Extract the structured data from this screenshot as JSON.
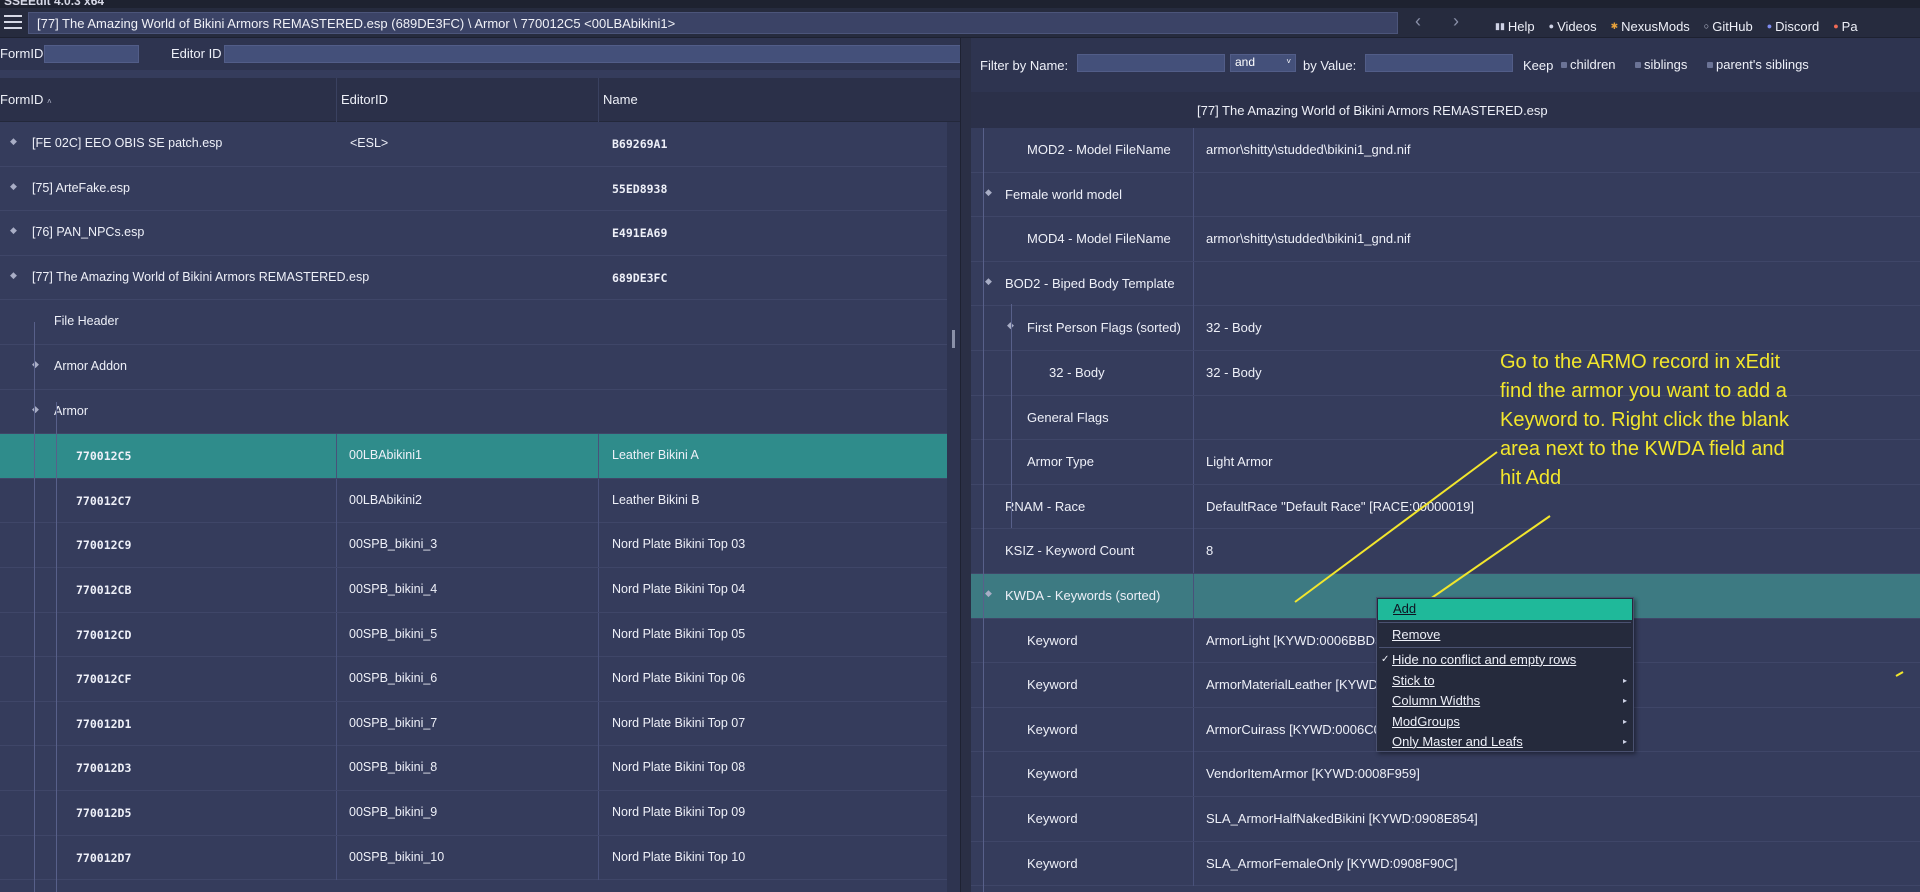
{
  "window": {
    "title": "SSEEdit 4.0.3 x64"
  },
  "topbar": {
    "path": "[77] The Amazing World of Bikini Armors REMASTERED.esp (689DE3FC) \\ Armor \\ 770012C5 <00LBAbikini1>",
    "back_icon": "chevron-left-icon",
    "forward_icon": "chevron-right-icon",
    "links": [
      {
        "label": "Help",
        "icon": "book-icon"
      },
      {
        "label": "Videos",
        "icon": "video-icon"
      },
      {
        "label": "NexusMods",
        "icon": "nexus-icon"
      },
      {
        "label": "GitHub",
        "icon": "github-icon"
      },
      {
        "label": "Discord",
        "icon": "discord-icon"
      },
      {
        "label": "Pa",
        "icon": "patreon-icon"
      }
    ]
  },
  "left": {
    "filter": {
      "formid_label": "FormID",
      "editorid_label": "Editor ID",
      "formid_value": "",
      "editorid_value": ""
    },
    "columns": {
      "formid": "FormID",
      "editorid": "EditorID",
      "name": "Name"
    },
    "rows": [
      {
        "formid": "[FE 02C] EEO OBIS SE patch.esp",
        "editorid": "<ESL>",
        "name": "B69269A1",
        "level": 0,
        "expand": true
      },
      {
        "formid": "[75] ArteFake.esp",
        "editorid": "",
        "name": "55ED8938",
        "level": 0,
        "expand": true
      },
      {
        "formid": "[76] PAN_NPCs.esp",
        "editorid": "",
        "name": "E491EA69",
        "level": 0,
        "expand": true
      },
      {
        "formid": "[77] The Amazing World of Bikini Armors REMASTERED.esp",
        "editorid": "",
        "name": "689DE3FC",
        "level": 0,
        "expand": true
      },
      {
        "formid": "File Header",
        "editorid": "",
        "name": "",
        "level": 1,
        "expand": false
      },
      {
        "formid": "Armor Addon",
        "editorid": "",
        "name": "",
        "level": 1,
        "expand": true
      },
      {
        "formid": "Armor",
        "editorid": "",
        "name": "",
        "level": 1,
        "expand": true
      },
      {
        "formid": "770012C5",
        "editorid": "00LBAbikini1",
        "name": "Leather Bikini A",
        "level": 2,
        "selected": true
      },
      {
        "formid": "770012C7",
        "editorid": "00LBAbikini2",
        "name": "Leather Bikini B",
        "level": 2
      },
      {
        "formid": "770012C9",
        "editorid": "00SPB_bikini_3",
        "name": "Nord Plate Bikini Top 03",
        "level": 2
      },
      {
        "formid": "770012CB",
        "editorid": "00SPB_bikini_4",
        "name": "Nord Plate Bikini Top 04",
        "level": 2
      },
      {
        "formid": "770012CD",
        "editorid": "00SPB_bikini_5",
        "name": "Nord Plate Bikini Top 05",
        "level": 2
      },
      {
        "formid": "770012CF",
        "editorid": "00SPB_bikini_6",
        "name": "Nord Plate Bikini Top 06",
        "level": 2
      },
      {
        "formid": "770012D1",
        "editorid": "00SPB_bikini_7",
        "name": "Nord Plate Bikini Top 07",
        "level": 2
      },
      {
        "formid": "770012D3",
        "editorid": "00SPB_bikini_8",
        "name": "Nord Plate Bikini Top 08",
        "level": 2
      },
      {
        "formid": "770012D5",
        "editorid": "00SPB_bikini_9",
        "name": "Nord Plate Bikini Top 09",
        "level": 2
      },
      {
        "formid": "770012D7",
        "editorid": "00SPB_bikini_10",
        "name": "Nord Plate Bikini Top 10",
        "level": 2
      }
    ]
  },
  "right": {
    "filter": {
      "by_name_label": "Filter by Name:",
      "name_value": "",
      "op": "and",
      "by_value_label": "by Value:",
      "value_value": "",
      "keep_label": "Keep",
      "options": [
        "children",
        "siblings",
        "parent's siblings"
      ]
    },
    "header": "[77] The Amazing World of Bikini Armors REMASTERED.esp",
    "rows": [
      {
        "label": "MOD2 - Model FileName",
        "value": "armor\\shitty\\studded\\bikini1_gnd.nif",
        "level": 2
      },
      {
        "label": "Female world model",
        "value": "",
        "level": 1,
        "expand": true
      },
      {
        "label": "MOD4 - Model FileName",
        "value": "armor\\shitty\\studded\\bikini1_gnd.nif",
        "level": 2
      },
      {
        "label": "BOD2 - Biped Body Template",
        "value": "",
        "level": 1,
        "expand": true
      },
      {
        "label": "First Person Flags (sorted)",
        "value": "32 - Body",
        "level": 2,
        "expand": true
      },
      {
        "label": "32 - Body",
        "value": "32 - Body",
        "level": 3
      },
      {
        "label": "General Flags",
        "value": "",
        "level": 2
      },
      {
        "label": "Armor Type",
        "value": "Light Armor",
        "level": 2
      },
      {
        "label": "RNAM - Race",
        "value": "DefaultRace \"Default Race\" [RACE:00000019]",
        "level": 1
      },
      {
        "label": "KSIZ - Keyword Count",
        "value": "8",
        "level": 1
      },
      {
        "label": "KWDA - Keywords (sorted)",
        "value": "",
        "level": 1,
        "expand": true,
        "kwda": true
      },
      {
        "label": "Keyword",
        "value": "ArmorLight [KYWD:0006BBD3]",
        "level": 2
      },
      {
        "label": "Keyword",
        "value": "ArmorMaterialLeather [KYWD:0006BBDB]",
        "level": 2
      },
      {
        "label": "Keyword",
        "value": "ArmorCuirass [KYWD:0006C0EC]",
        "level": 2
      },
      {
        "label": "Keyword",
        "value": "VendorItemArmor [KYWD:0008F959]",
        "level": 2
      },
      {
        "label": "Keyword",
        "value": "SLA_ArmorHalfNakedBikini [KYWD:0908E854]",
        "level": 2
      },
      {
        "label": "Keyword",
        "value": "SLA_ArmorFemaleOnly [KYWD:0908F90C]",
        "level": 2
      }
    ]
  },
  "context_menu": {
    "items": [
      {
        "label": "Add",
        "highlighted": true
      },
      {
        "separator": true
      },
      {
        "label": "Remove"
      },
      {
        "separator": true
      },
      {
        "label": "Hide no conflict and empty rows",
        "checked": true
      },
      {
        "label": "Stick to",
        "submenu": true
      },
      {
        "label": "Column Widths",
        "submenu": true
      },
      {
        "label": "ModGroups",
        "submenu": true
      },
      {
        "label": "Only Master and Leafs",
        "submenu": true
      }
    ]
  },
  "annotation": {
    "text": "Go to the ARMO record in xEdit find the armor you want to add a Keyword to. Right click the blank area next to the KWDA field and hit Add",
    "color": "#f2e62c"
  },
  "colors": {
    "background": "#353c5c",
    "selected_row": "#2f8c8b",
    "kwda_row": "#3d7a82",
    "menu_highlight": "#1fb99a"
  }
}
